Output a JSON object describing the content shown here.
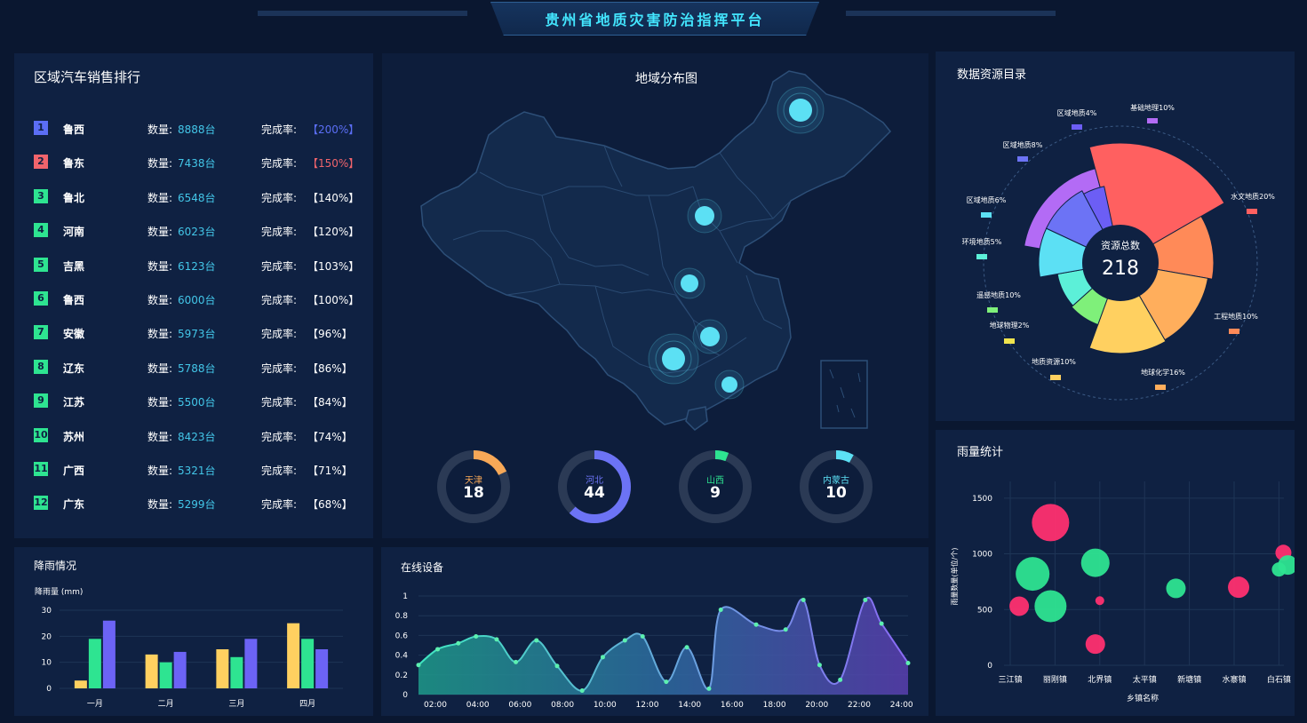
{
  "header": {
    "title": "贵州省地质灾害防治指挥平台"
  },
  "ranking": {
    "title": "区域汽车销售排行",
    "qty_label": "数量:",
    "rate_label": "完成率:",
    "items": [
      {
        "rank": "1",
        "name": "鲁西",
        "qty": "8888台",
        "rate": "【200%】",
        "badge_color": "#5b6ef5",
        "rate_color": "#5b6ef5"
      },
      {
        "rank": "2",
        "name": "鲁东",
        "qty": "7438台",
        "rate": "【150%】",
        "badge_color": "#f1646c",
        "rate_color": "#f1646c"
      },
      {
        "rank": "3",
        "name": "鲁北",
        "qty": "6548台",
        "rate": "【140%】",
        "badge_color": "#2ee491",
        "rate_color": "#ffffff"
      },
      {
        "rank": "4",
        "name": "河南",
        "qty": "6023台",
        "rate": "【120%】",
        "badge_color": "#2ee491",
        "rate_color": "#ffffff"
      },
      {
        "rank": "5",
        "name": "吉黑",
        "qty": "6123台",
        "rate": "【103%】",
        "badge_color": "#2ee491",
        "rate_color": "#ffffff"
      },
      {
        "rank": "6",
        "name": "鲁西",
        "qty": "6000台",
        "rate": "【100%】",
        "badge_color": "#2ee491",
        "rate_color": "#ffffff"
      },
      {
        "rank": "7",
        "name": "安徽",
        "qty": "5973台",
        "rate": "【96%】",
        "badge_color": "#2ee491",
        "rate_color": "#ffffff"
      },
      {
        "rank": "8",
        "name": "辽东",
        "qty": "5788台",
        "rate": "【86%】",
        "badge_color": "#2ee491",
        "rate_color": "#ffffff"
      },
      {
        "rank": "9",
        "name": "江苏",
        "qty": "5500台",
        "rate": "【84%】",
        "badge_color": "#2ee491",
        "rate_color": "#ffffff"
      },
      {
        "rank": "10",
        "name": "苏州",
        "qty": "8423台",
        "rate": "【74%】",
        "badge_color": "#2ee491",
        "rate_color": "#ffffff"
      },
      {
        "rank": "11",
        "name": "广西",
        "qty": "5321台",
        "rate": "【71%】",
        "badge_color": "#2ee491",
        "rate_color": "#ffffff"
      },
      {
        "rank": "12",
        "name": "广东",
        "qty": "5299台",
        "rate": "【68%】",
        "badge_color": "#2ee491",
        "rate_color": "#ffffff"
      }
    ]
  },
  "map": {
    "title": "地域分布图",
    "rings": [
      {
        "name": "天津",
        "value": "18",
        "fraction": 0.18,
        "color": "#f7a857"
      },
      {
        "name": "河北",
        "value": "44",
        "fraction": 0.62,
        "color": "#6c73f5"
      },
      {
        "name": "山西",
        "value": "9",
        "fraction": 0.06,
        "color": "#2ee491"
      },
      {
        "name": "内蒙古",
        "value": "10",
        "fraction": 0.08,
        "color": "#5ce0f4"
      }
    ]
  },
  "catalog": {
    "title": "数据资源目录",
    "center_label": "资源总数",
    "center_value": "218",
    "labels": [
      {
        "text": "基础地理10%",
        "color": "#b36bf5"
      },
      {
        "text": "区域地质4%",
        "color": "#6c5ef5"
      },
      {
        "text": "区域地质8%",
        "color": "#6c73f5"
      },
      {
        "text": "区域地质6%",
        "color": "#5ce0f4"
      },
      {
        "text": "环境地质5%",
        "color": "#5cf0d8"
      },
      {
        "text": "遥感地质10%",
        "color": "#7ff07a"
      },
      {
        "text": "地球物理2%",
        "color": "#f0e44e"
      },
      {
        "text": "地质资源10%",
        "color": "#ffd060"
      },
      {
        "text": "地球化学16%",
        "color": "#ffae5c"
      },
      {
        "text": "工程地质10%",
        "color": "#ff8a58"
      },
      {
        "text": "水文地质20%",
        "color": "#ff6060"
      }
    ]
  },
  "rain": {
    "title": "降雨情况",
    "unit_label": "降雨量 (mm)",
    "colors": [
      "#ffd060",
      "#2ee491",
      "#6c63f5"
    ],
    "chart_data": {
      "type": "bar",
      "categories": [
        "一月",
        "二月",
        "三月",
        "四月"
      ],
      "series": [
        {
          "values": [
            3,
            13,
            15,
            25
          ]
        },
        {
          "values": [
            19,
            10,
            12,
            19
          ]
        },
        {
          "values": [
            26,
            14,
            19,
            15
          ]
        }
      ],
      "yticks": [
        "0",
        "10",
        "20",
        "30"
      ],
      "ylim": [
        0,
        30
      ]
    }
  },
  "online": {
    "title": "在线设备",
    "chart_data": {
      "type": "area",
      "x": [
        "02:00",
        "04:00",
        "06:00",
        "08:00",
        "10:00",
        "12:00",
        "14:00",
        "16:00",
        "18:00",
        "20:00",
        "22:00",
        "24:00"
      ],
      "points": [
        [
          1.0,
          0.3
        ],
        [
          1.65,
          0.46
        ],
        [
          2.35,
          0.52
        ],
        [
          2.95,
          0.59
        ],
        [
          3.65,
          0.56
        ],
        [
          4.3,
          0.33
        ],
        [
          5.0,
          0.55
        ],
        [
          5.7,
          0.29
        ],
        [
          6.55,
          0.04
        ],
        [
          7.25,
          0.38
        ],
        [
          8.0,
          0.55
        ],
        [
          8.6,
          0.59
        ],
        [
          9.4,
          0.13
        ],
        [
          10.1,
          0.48
        ],
        [
          10.85,
          0.06
        ],
        [
          11.25,
          0.86
        ],
        [
          12.45,
          0.71
        ],
        [
          13.45,
          0.66
        ],
        [
          14.05,
          0.96
        ],
        [
          14.6,
          0.3
        ],
        [
          15.3,
          0.15
        ],
        [
          16.15,
          0.96
        ],
        [
          16.7,
          0.72
        ],
        [
          17.6,
          0.32
        ]
      ],
      "yticks": [
        "0",
        "0.2",
        "0.4",
        "0.6",
        "0.8",
        "1"
      ],
      "ylim": [
        0,
        1
      ]
    }
  },
  "rainfall_stats": {
    "title": "雨量统计",
    "ylabel": "雨量数量(单位/个)",
    "xlabel": "乡镇名称",
    "chart_data": {
      "type": "scatter",
      "categories": [
        "三江镇",
        "丽刚镇",
        "北界镇",
        "太平镇",
        "新塘镇",
        "水寨镇",
        "白石镇"
      ],
      "yticks": [
        "0",
        "500",
        "1000",
        "1500"
      ],
      "ylim": [
        0,
        1650
      ],
      "points": [
        {
          "x": 0.9,
          "y": 1280,
          "r": 21,
          "color": "#ff3070"
        },
        {
          "x": 0.5,
          "y": 820,
          "r": 19,
          "color": "#2ee491"
        },
        {
          "x": 1.9,
          "y": 920,
          "r": 16,
          "color": "#2ee491"
        },
        {
          "x": 0.2,
          "y": 530,
          "r": 11,
          "color": "#ff3070"
        },
        {
          "x": 0.9,
          "y": 530,
          "r": 18,
          "color": "#2ee491"
        },
        {
          "x": 2.0,
          "y": 580,
          "r": 5,
          "color": "#ff3070"
        },
        {
          "x": 1.9,
          "y": 190,
          "r": 11,
          "color": "#ff3070"
        },
        {
          "x": 3.7,
          "y": 690,
          "r": 11,
          "color": "#2ee491"
        },
        {
          "x": 5.1,
          "y": 700,
          "r": 12,
          "color": "#ff3070"
        },
        {
          "x": 6.1,
          "y": 1010,
          "r": 9,
          "color": "#ff3070"
        },
        {
          "x": 6.2,
          "y": 900,
          "r": 11,
          "color": "#2ee491"
        },
        {
          "x": 6.0,
          "y": 860,
          "r": 8,
          "color": "#2ee491"
        }
      ]
    }
  }
}
